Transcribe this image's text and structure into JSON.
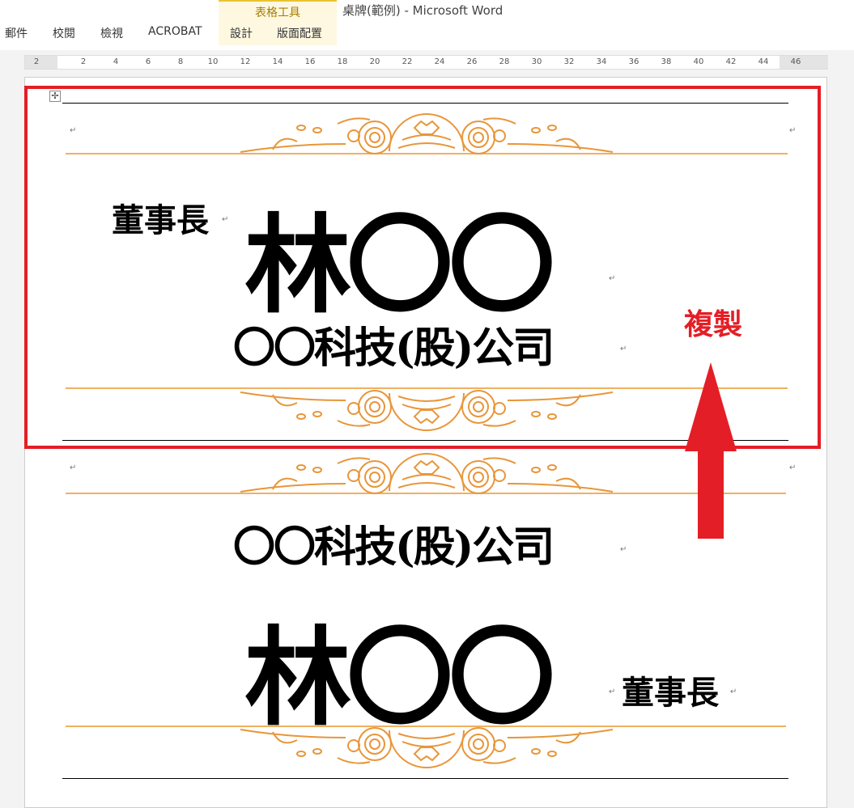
{
  "window": {
    "title": "桌牌(範例) - Microsoft Word",
    "context_group": "表格工具"
  },
  "tabs": [
    "郵件",
    "校閱",
    "檢視",
    "ACROBAT",
    "設計",
    "版面配置"
  ],
  "ruler": {
    "left": "2",
    "ticks": [
      "2",
      "4",
      "6",
      "8",
      "10",
      "12",
      "14",
      "16",
      "18",
      "20",
      "22",
      "24",
      "26",
      "28",
      "30",
      "32",
      "34",
      "36",
      "38",
      "40",
      "42",
      "44",
      "46"
    ]
  },
  "card1": {
    "title": "董事長",
    "name": "林〇〇",
    "company": "〇〇科技(股)公司"
  },
  "card2": {
    "company": "〇〇科技(股)公司",
    "name": "林〇〇",
    "title": "董事長"
  },
  "annotation": {
    "label": "複製",
    "color": "#e41e26"
  },
  "colors": {
    "ornament": "#e8963a",
    "highlight": "#e41e26"
  }
}
